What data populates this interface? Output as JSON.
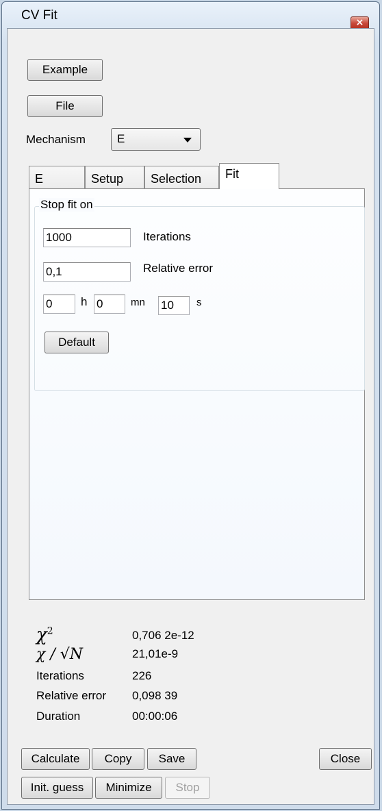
{
  "window": {
    "title": "CV Fit",
    "close_glyph": "×"
  },
  "buttons": {
    "example": "Example",
    "file": "File",
    "default": "Default",
    "calculate": "Calculate",
    "copy": "Copy",
    "save": "Save",
    "close": "Close",
    "init_guess": "Init. guess",
    "minimize": "Minimize",
    "stop": "Stop"
  },
  "mechanism": {
    "label": "Mechanism",
    "value": "E"
  },
  "tabs": [
    "E",
    "Setup",
    "Selection",
    "Fit"
  ],
  "active_tab": "Fit",
  "stop_fit": {
    "title": "Stop fit on",
    "iterations_value": "1000",
    "iterations_label": "Iterations",
    "relerr_value": "0,1",
    "relerr_label": "Relative error",
    "hours": "0",
    "hours_unit": "h",
    "minutes": "0",
    "minutes_unit": "mn",
    "seconds": "10",
    "seconds_unit": "s"
  },
  "results": {
    "chi2_symbol": "χ",
    "chi2_sup": "2",
    "chi2_value": "0,706 2e-12",
    "chi_sqrt_symbol": "χ / √N",
    "chi_sqrt_value": "21,01e-9",
    "iterations_label": "Iterations",
    "iterations_value": "226",
    "relerr_label": "Relative error",
    "relerr_value": "0,098 39",
    "duration_label": "Duration",
    "duration_value": "00:00:06"
  },
  "colors": {
    "accent_close": "#c8493a",
    "window_frame": "#cfdceb"
  }
}
